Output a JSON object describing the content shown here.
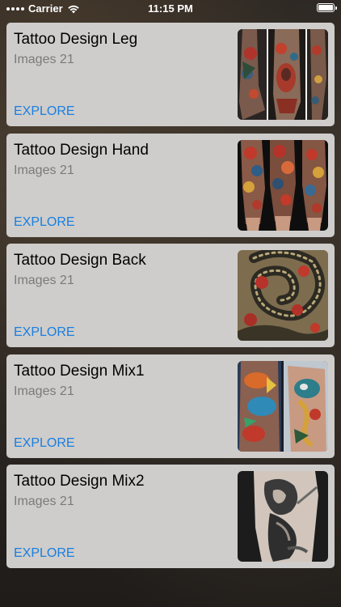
{
  "status_bar": {
    "carrier": "Carrier",
    "time": "11:15 PM"
  },
  "cards": [
    {
      "title": "Tattoo Design Leg",
      "subtitle": "Images 21",
      "action": "EXPLORE",
      "image_icon": "leg-tattoo-photo"
    },
    {
      "title": "Tattoo Design Hand",
      "subtitle": "Images 21",
      "action": "EXPLORE",
      "image_icon": "arm-sleeve-tattoo-photo"
    },
    {
      "title": "Tattoo Design Back",
      "subtitle": "Images 21",
      "action": "EXPLORE",
      "image_icon": "back-dragon-tattoo-photo"
    },
    {
      "title": "Tattoo Design Mix1",
      "subtitle": "Images 21",
      "action": "EXPLORE",
      "image_icon": "koi-sleeve-tattoo-photo"
    },
    {
      "title": "Tattoo Design Mix2",
      "subtitle": "Images 21",
      "action": "EXPLORE",
      "image_icon": "samurai-forearm-tattoo-photo"
    }
  ],
  "colors": {
    "card_background": "#cecdcb",
    "link": "#1a7ee0",
    "subtitle": "#7a7a7a"
  }
}
